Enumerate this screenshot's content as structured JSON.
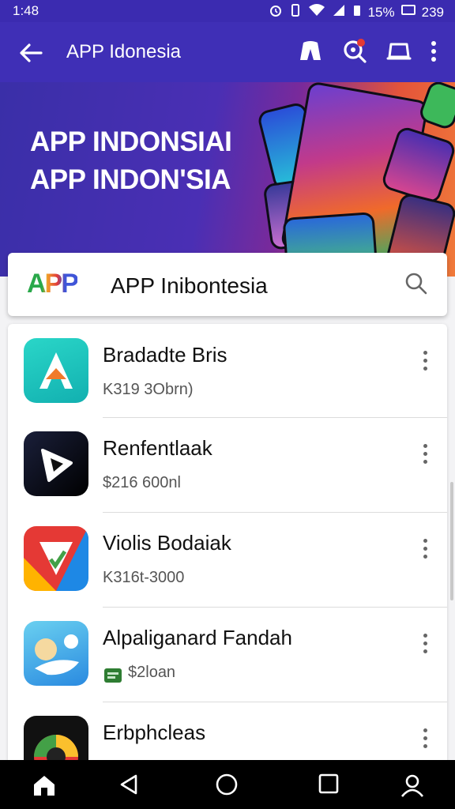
{
  "status_bar": {
    "time": "1:48",
    "battery_text": "15%",
    "extra_text": "239"
  },
  "app_bar": {
    "title": "APP Idonesia"
  },
  "banner": {
    "line1": "APP INDONSIAI",
    "line2": "APP INDON'SIA"
  },
  "search": {
    "logo_text": "APP",
    "query": "APP Inibontesia"
  },
  "apps": [
    {
      "name": "Bradadte Bris",
      "sub": "K319 3Obrn)"
    },
    {
      "name": "Renfentlaak",
      "sub": "$216 600nl"
    },
    {
      "name": "Violis Bodaiak",
      "sub": "K316t-3000"
    },
    {
      "name": "Alpaliganard Fandah",
      "sub": "$2loan"
    },
    {
      "name": "Erbphcleas",
      "sub": ""
    }
  ],
  "colors": {
    "primary": "#3f2fb6",
    "accent_orange": "#f07a3a",
    "background": "#f3f3f5"
  }
}
